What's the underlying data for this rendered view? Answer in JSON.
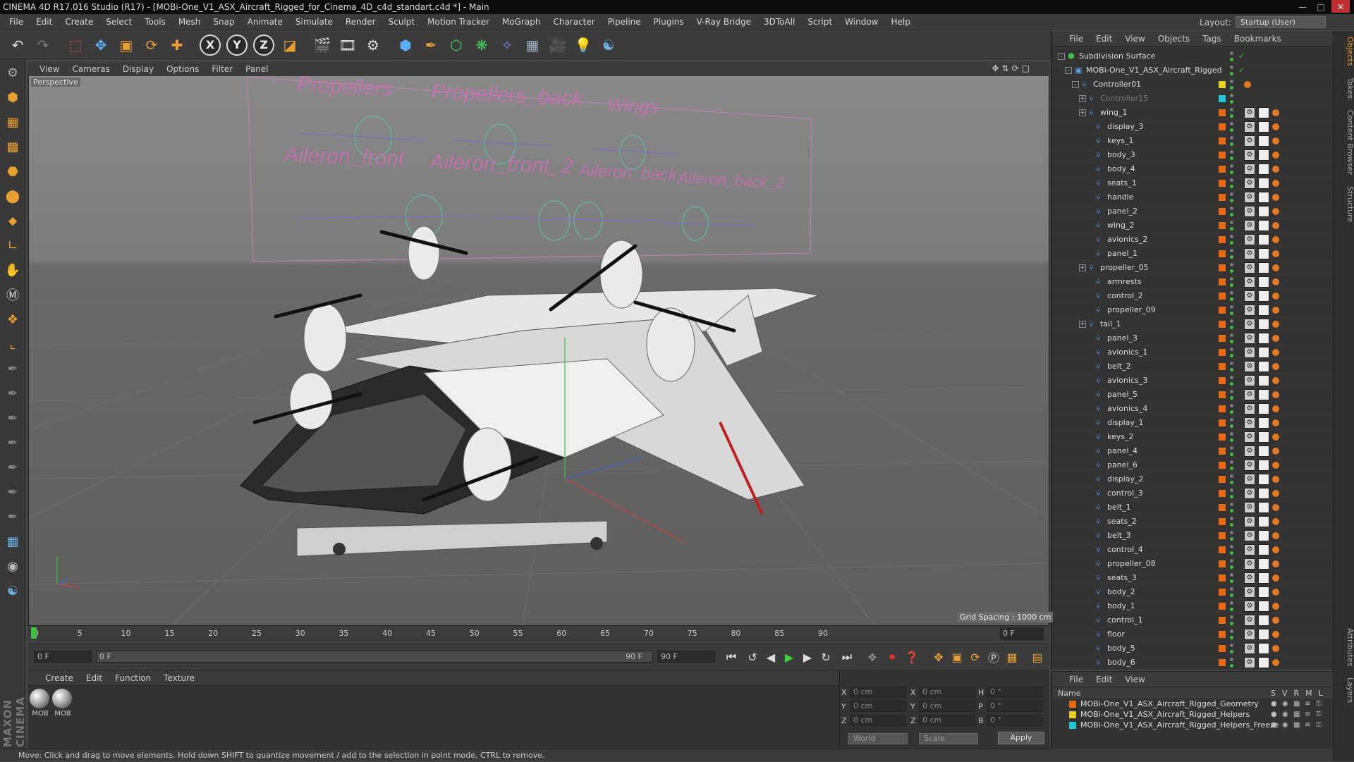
{
  "window": {
    "title": "CINEMA 4D R17.016 Studio (R17) - [MOBi-One_V1_ASX_Aircraft_Rigged_for_Cinema_4D_c4d_standart.c4d *] - Main"
  },
  "menubar": [
    "File",
    "Edit",
    "Create",
    "Select",
    "Tools",
    "Mesh",
    "Snap",
    "Animate",
    "Simulate",
    "Render",
    "Sculpt",
    "Motion Tracker",
    "MoGraph",
    "Character",
    "Pipeline",
    "Plugins",
    "V-Ray Bridge",
    "3DToAll",
    "Script",
    "Window",
    "Help"
  ],
  "layout": {
    "label": "Layout:",
    "value": "Startup (User)"
  },
  "viewport": {
    "menu": [
      "View",
      "Cameras",
      "Display",
      "Options",
      "Filter",
      "Panel"
    ],
    "camera_label": "Perspective",
    "grid_spacing": "Grid Spacing : 1000 cm",
    "controller_labels": [
      "Propellers",
      "Propellers_back",
      "Wings",
      "Aileron_front",
      "Aileron_front_2",
      "Aileron_back",
      "Aileron_back_2"
    ]
  },
  "timeline": {
    "ticks": [
      "0",
      "5",
      "10",
      "15",
      "20",
      "25",
      "30",
      "35",
      "40",
      "45",
      "50",
      "55",
      "60",
      "65",
      "70",
      "75",
      "80",
      "85",
      "90"
    ],
    "current_frame": "0 F"
  },
  "transport": {
    "start_field": "0 F",
    "range_start": "0 F",
    "range_end": "90 F",
    "end_field": "90 F"
  },
  "material_manager": {
    "menu": [
      "Create",
      "Edit",
      "Function",
      "Texture"
    ],
    "materials": [
      "MOB",
      "MOB"
    ]
  },
  "coordinates": {
    "labels_pos": [
      "X",
      "Y",
      "Z"
    ],
    "labels_size": [
      "X",
      "Y",
      "Z"
    ],
    "labels_rot": [
      "H",
      "P",
      "B"
    ],
    "pos": [
      "0 cm",
      "0 cm",
      "0 cm"
    ],
    "size": [
      "0 cm",
      "0 cm",
      "0 cm"
    ],
    "rot": [
      "0 °",
      "0 °",
      "0 °"
    ],
    "mode_world": "World",
    "mode_scale": "Scale",
    "apply": "Apply"
  },
  "object_manager": {
    "menu": [
      "File",
      "Edit",
      "View",
      "Objects",
      "Tags",
      "Bookmarks"
    ],
    "rows": [
      {
        "name": "Subdivision Surface",
        "level": 0,
        "exp": "-",
        "color": "",
        "kind": "sds"
      },
      {
        "name": "MOBi-One_V1_ASX_Aircraft_Rigged",
        "level": 1,
        "exp": "-",
        "color": "",
        "kind": "null"
      },
      {
        "name": "Controller01",
        "level": 2,
        "exp": "-",
        "color": "#e8d020",
        "kind": "ctrl"
      },
      {
        "name": "Controller15",
        "level": 3,
        "exp": "+",
        "color": "#20c8d8",
        "kind": "ghost"
      },
      {
        "name": "wing_1",
        "level": 3,
        "exp": "+",
        "color": "#e86a10",
        "kind": "bone"
      },
      {
        "name": "display_3",
        "level": 4,
        "exp": "",
        "color": "#e86a10",
        "kind": "bone"
      },
      {
        "name": "keys_1",
        "level": 4,
        "exp": "",
        "color": "#e86a10",
        "kind": "bone"
      },
      {
        "name": "body_3",
        "level": 4,
        "exp": "",
        "color": "#e86a10",
        "kind": "bone"
      },
      {
        "name": "body_4",
        "level": 4,
        "exp": "",
        "color": "#e86a10",
        "kind": "bone"
      },
      {
        "name": "seats_1",
        "level": 4,
        "exp": "",
        "color": "#e86a10",
        "kind": "bone"
      },
      {
        "name": "handle",
        "level": 4,
        "exp": "",
        "color": "#e86a10",
        "kind": "bone"
      },
      {
        "name": "panel_2",
        "level": 4,
        "exp": "",
        "color": "#e86a10",
        "kind": "bone"
      },
      {
        "name": "wing_2",
        "level": 4,
        "exp": "",
        "color": "#e86a10",
        "kind": "bone"
      },
      {
        "name": "avionics_2",
        "level": 4,
        "exp": "",
        "color": "#e86a10",
        "kind": "bone"
      },
      {
        "name": "panel_1",
        "level": 4,
        "exp": "",
        "color": "#e86a10",
        "kind": "bone"
      },
      {
        "name": "propeller_05",
        "level": 3,
        "exp": "+",
        "color": "#e86a10",
        "kind": "bone"
      },
      {
        "name": "armrests",
        "level": 4,
        "exp": "",
        "color": "#e86a10",
        "kind": "bone"
      },
      {
        "name": "control_2",
        "level": 4,
        "exp": "",
        "color": "#e86a10",
        "kind": "bone"
      },
      {
        "name": "propeller_09",
        "level": 4,
        "exp": "",
        "color": "#e86a10",
        "kind": "bone"
      },
      {
        "name": "tail_1",
        "level": 3,
        "exp": "+",
        "color": "#e86a10",
        "kind": "bone"
      },
      {
        "name": "panel_3",
        "level": 4,
        "exp": "",
        "color": "#e86a10",
        "kind": "bone"
      },
      {
        "name": "avionics_1",
        "level": 4,
        "exp": "",
        "color": "#e86a10",
        "kind": "bone"
      },
      {
        "name": "belt_2",
        "level": 4,
        "exp": "",
        "color": "#e86a10",
        "kind": "bone"
      },
      {
        "name": "avionics_3",
        "level": 4,
        "exp": "",
        "color": "#e86a10",
        "kind": "bone"
      },
      {
        "name": "panel_5",
        "level": 4,
        "exp": "",
        "color": "#e86a10",
        "kind": "bone"
      },
      {
        "name": "avionics_4",
        "level": 4,
        "exp": "",
        "color": "#e86a10",
        "kind": "bone"
      },
      {
        "name": "display_1",
        "level": 4,
        "exp": "",
        "color": "#e86a10",
        "kind": "bone"
      },
      {
        "name": "keys_2",
        "level": 4,
        "exp": "",
        "color": "#e86a10",
        "kind": "bone"
      },
      {
        "name": "panel_4",
        "level": 4,
        "exp": "",
        "color": "#e86a10",
        "kind": "bone"
      },
      {
        "name": "panel_6",
        "level": 4,
        "exp": "",
        "color": "#e86a10",
        "kind": "bone"
      },
      {
        "name": "display_2",
        "level": 4,
        "exp": "",
        "color": "#e86a10",
        "kind": "bone"
      },
      {
        "name": "control_3",
        "level": 4,
        "exp": "",
        "color": "#e86a10",
        "kind": "bone"
      },
      {
        "name": "belt_1",
        "level": 4,
        "exp": "",
        "color": "#e86a10",
        "kind": "bone"
      },
      {
        "name": "seats_2",
        "level": 4,
        "exp": "",
        "color": "#e86a10",
        "kind": "bone"
      },
      {
        "name": "belt_3",
        "level": 4,
        "exp": "",
        "color": "#e86a10",
        "kind": "bone"
      },
      {
        "name": "control_4",
        "level": 4,
        "exp": "",
        "color": "#e86a10",
        "kind": "bone"
      },
      {
        "name": "propeller_08",
        "level": 4,
        "exp": "",
        "color": "#e86a10",
        "kind": "bone"
      },
      {
        "name": "seats_3",
        "level": 4,
        "exp": "",
        "color": "#e86a10",
        "kind": "bone"
      },
      {
        "name": "body_2",
        "level": 4,
        "exp": "",
        "color": "#e86a10",
        "kind": "bone"
      },
      {
        "name": "body_1",
        "level": 4,
        "exp": "",
        "color": "#e86a10",
        "kind": "bone"
      },
      {
        "name": "control_1",
        "level": 4,
        "exp": "",
        "color": "#e86a10",
        "kind": "bone"
      },
      {
        "name": "floor",
        "level": 4,
        "exp": "",
        "color": "#e86a10",
        "kind": "bone"
      },
      {
        "name": "body_5",
        "level": 4,
        "exp": "",
        "color": "#e86a10",
        "kind": "bone"
      },
      {
        "name": "body_6",
        "level": 4,
        "exp": "",
        "color": "#e86a10",
        "kind": "bone"
      }
    ]
  },
  "layer_manager": {
    "menu": [
      "File",
      "Edit",
      "View"
    ],
    "header_name": "Name",
    "header_cols": [
      "S",
      "V",
      "R",
      "M",
      "L"
    ],
    "layers": [
      {
        "name": "MOBi-One_V1_ASX_Aircraft_Rigged_Geometry",
        "color": "#e86a10"
      },
      {
        "name": "MOBi-One_V1_ASX_Aircraft_Rigged_Helpers",
        "color": "#e8d020"
      },
      {
        "name": "MOBi-One_V1_ASX_Aircraft_Rigged_Helpers_Freeze",
        "color": "#20c8d8"
      }
    ]
  },
  "side_tabs": [
    "Objects",
    "Takes",
    "Content Browser",
    "Structure",
    "Attributes",
    "Layers"
  ],
  "status": "Move: Click and drag to move elements. Hold down SHIFT to quantize movement / add to the selection in point mode, CTRL to remove."
}
